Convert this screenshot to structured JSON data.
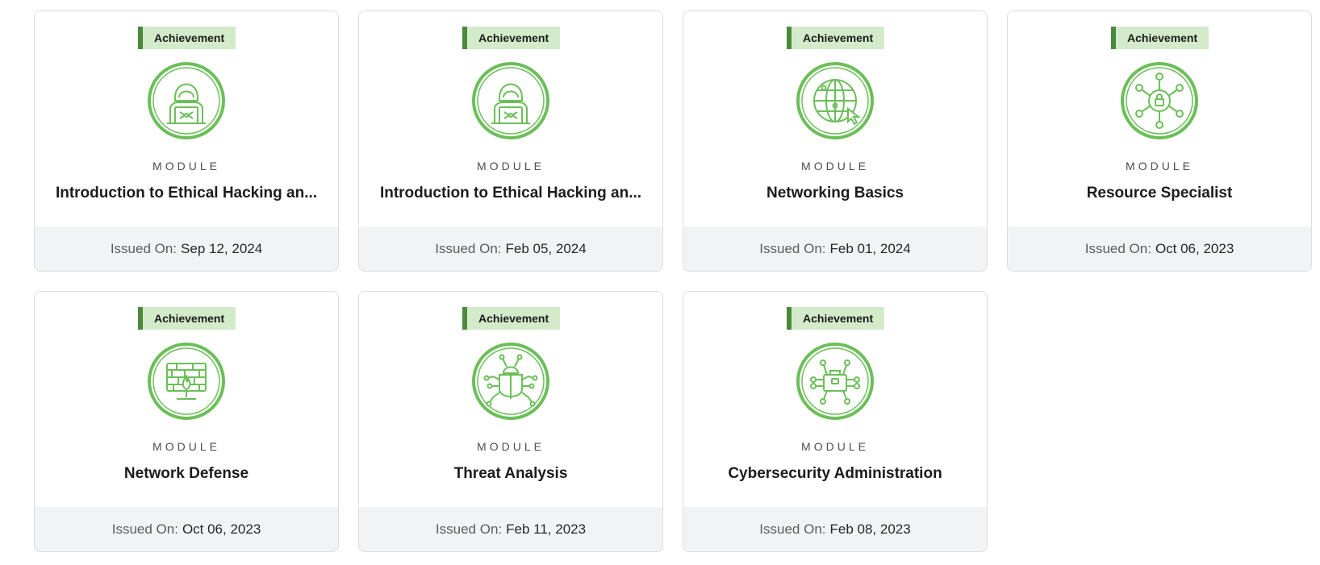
{
  "colors": {
    "accent": "#6bbf59",
    "badge_bg": "#d3ebca",
    "badge_bar": "#4a8a3b",
    "footer_bg": "#f2f3f5"
  },
  "cards": [
    {
      "badge": "Achievement",
      "icon": "hacker-icon",
      "kind": "MODULE",
      "title": "Introduction to Ethical Hacking an...",
      "issued_label": "Issued On:",
      "issued_date": "Sep 12, 2024"
    },
    {
      "badge": "Achievement",
      "icon": "hacker-icon",
      "kind": "MODULE",
      "title": "Introduction to Ethical Hacking an...",
      "issued_label": "Issued On:",
      "issued_date": "Feb 05, 2024"
    },
    {
      "badge": "Achievement",
      "icon": "globe-network-icon",
      "kind": "MODULE",
      "title": "Networking Basics",
      "issued_label": "Issued On:",
      "issued_date": "Feb 01, 2024"
    },
    {
      "badge": "Achievement",
      "icon": "network-lock-icon",
      "kind": "MODULE",
      "title": "Resource Specialist",
      "issued_label": "Issued On:",
      "issued_date": "Oct 06, 2023"
    },
    {
      "badge": "Achievement",
      "icon": "firewall-monitor-icon",
      "kind": "MODULE",
      "title": "Network Defense",
      "issued_label": "Issued On:",
      "issued_date": "Oct 06, 2023"
    },
    {
      "badge": "Achievement",
      "icon": "bug-icon",
      "kind": "MODULE",
      "title": "Threat Analysis",
      "issued_label": "Issued On:",
      "issued_date": "Feb 11, 2023"
    },
    {
      "badge": "Achievement",
      "icon": "briefcase-network-icon",
      "kind": "MODULE",
      "title": "Cybersecurity Administration",
      "issued_label": "Issued On:",
      "issued_date": "Feb 08, 2023"
    }
  ]
}
